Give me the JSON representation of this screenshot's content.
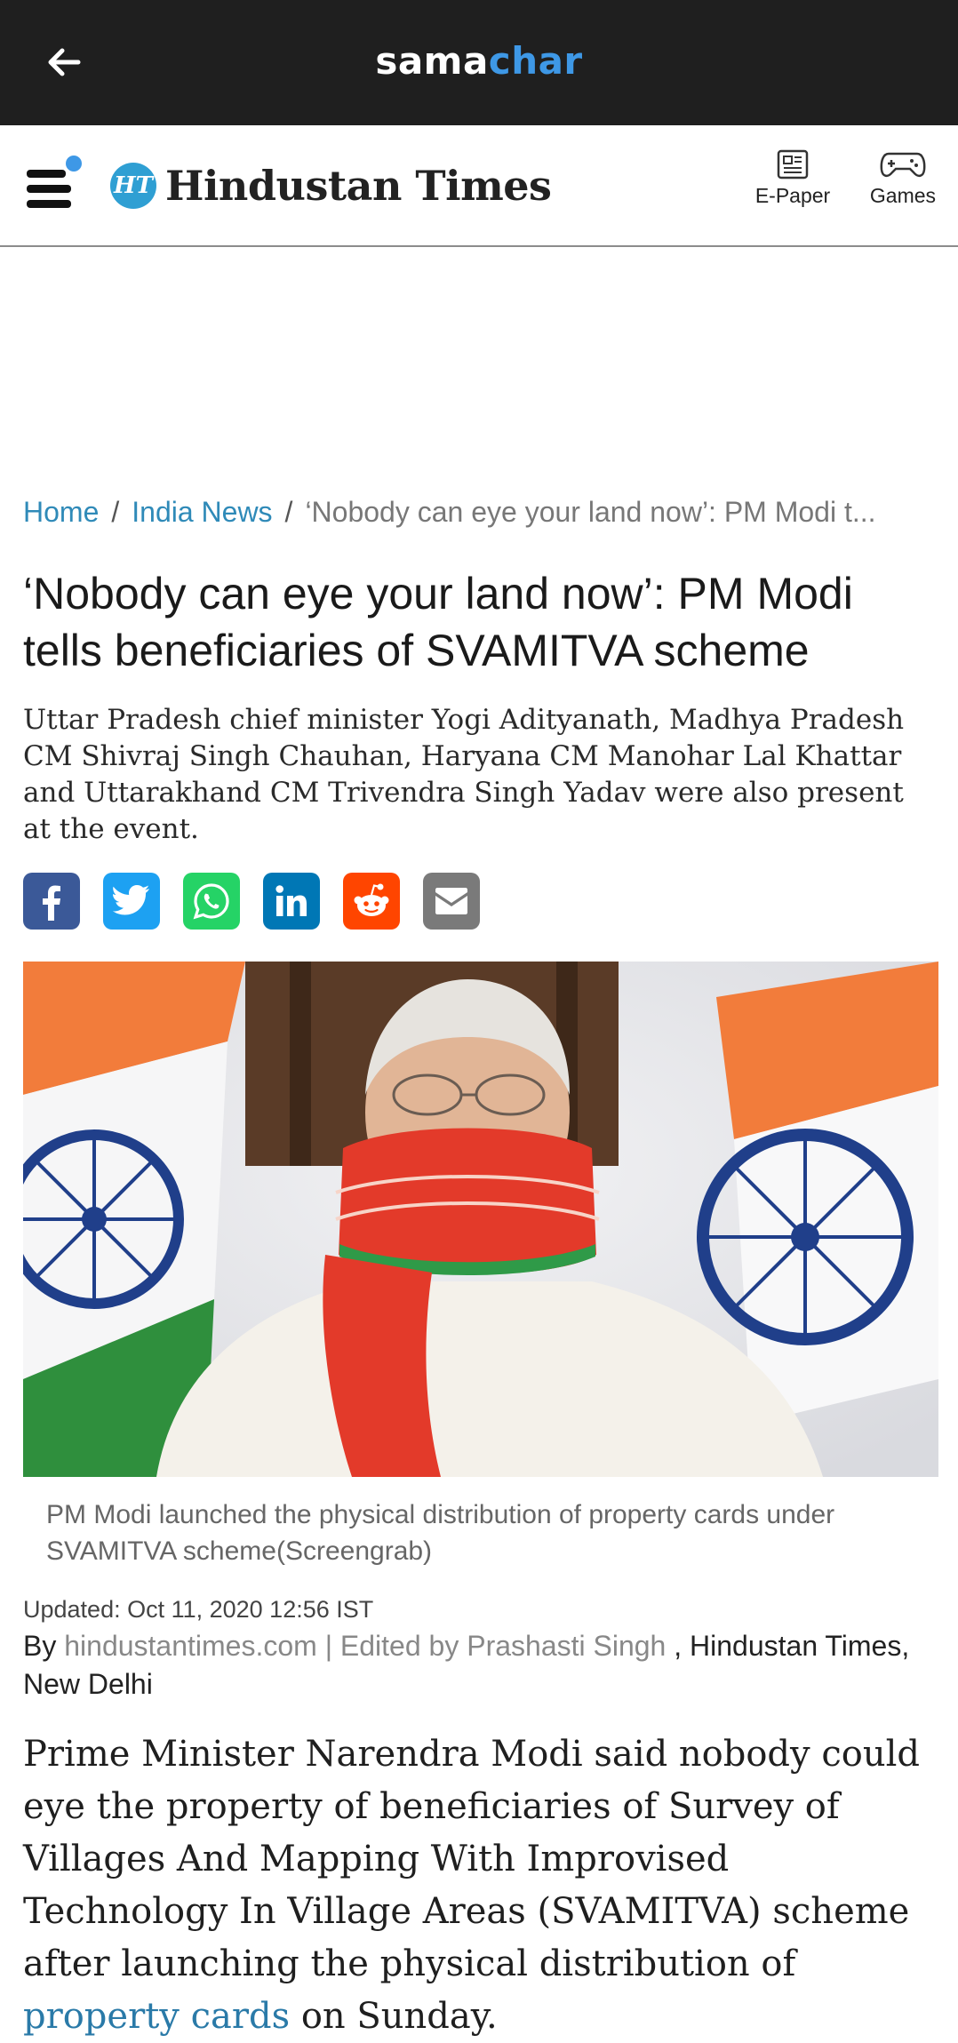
{
  "topbar": {
    "brand_part1": "sama",
    "brand_part2": "char"
  },
  "header": {
    "logo_mark": "HT",
    "logo_text": "Hindustan Times",
    "epaper_label": "E-Paper",
    "games_label": "Games"
  },
  "breadcrumb": {
    "home": "Home",
    "section": "India News",
    "current": "‘Nobody can eye your land now’: PM Modi t..."
  },
  "article": {
    "headline": "‘Nobody can eye your land now’: PM Modi tells beneficiaries of SVAMITVA scheme",
    "summary": "Uttar Pradesh chief minister Yogi Adityanath, Madhya Pradesh CM Shivraj Singh Chauhan, Haryana CM Manohar Lal Khattar and Uttarakhand CM Trivendra Singh Yadav were also present at the event.",
    "caption": "PM Modi launched the physical distribution of property cards under SVAMITVA scheme(Screengrab)",
    "updated": "Updated: Oct 11, 2020 12:56 IST",
    "by_prefix": "By",
    "byline_muted": "hindustantimes.com | Edited by Prashasti Singh",
    "byline_rest": ", Hindustan Times, New Delhi",
    "body_before_link": "Prime Minister Narendra Modi said nobody could eye the property of beneficiaries of Survey of Villages And Mapping With Improvised Technology In Village Areas (SVAMITVA) scheme after launching the physical distribution of ",
    "body_link": "property cards",
    "body_after_link": " on Sunday."
  },
  "share_buttons": [
    {
      "icon": "facebook-icon",
      "color": "#3b5998"
    },
    {
      "icon": "twitter-icon",
      "color": "#1da1f2"
    },
    {
      "icon": "whatsapp-icon",
      "color": "#25d366"
    },
    {
      "icon": "linkedin-icon",
      "color": "#0077b5"
    },
    {
      "icon": "reddit-icon",
      "color": "#ff4500"
    },
    {
      "icon": "email-icon",
      "color": "#7a7a7a"
    }
  ],
  "colors": {
    "topbar_bg": "#1f1f1f",
    "brand_accent": "#3e98e6",
    "link": "#2f8ab8"
  }
}
